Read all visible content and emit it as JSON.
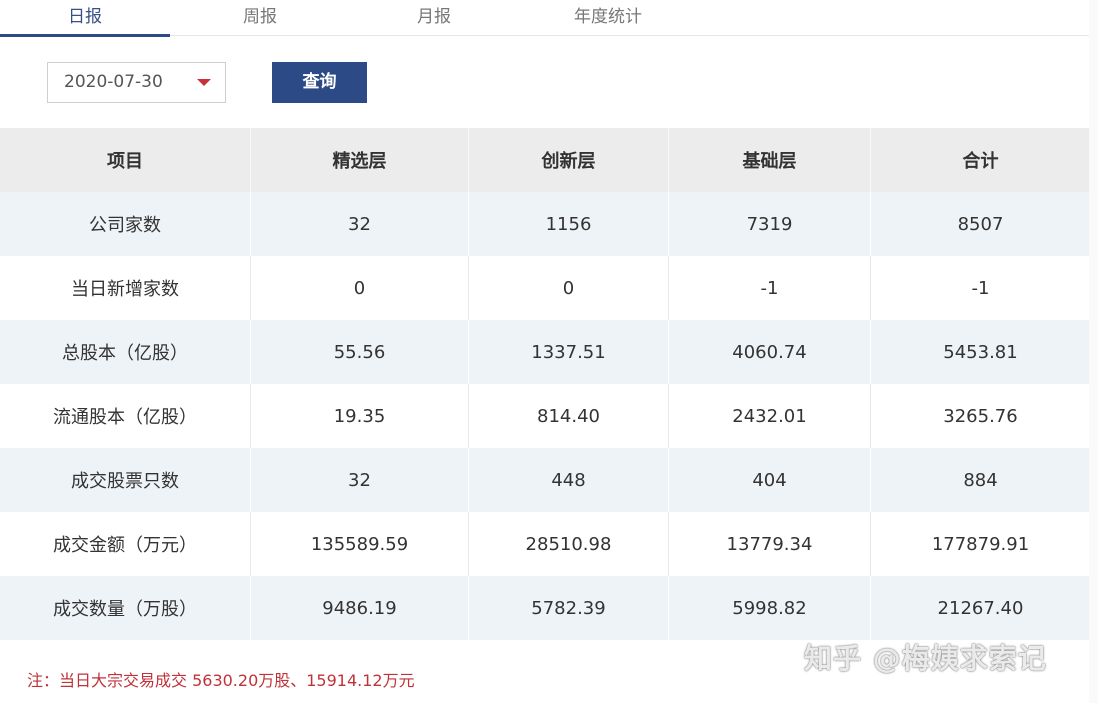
{
  "tabs": [
    {
      "label": "日报"
    },
    {
      "label": "周报"
    },
    {
      "label": "月报"
    },
    {
      "label": "年度统计"
    }
  ],
  "active_tab": "日报",
  "date_picker": {
    "value": "2020-07-30"
  },
  "query_button": {
    "label": "查询"
  },
  "table": {
    "headers": [
      "项目",
      "精选层",
      "创新层",
      "基础层",
      "合计"
    ],
    "rows": [
      [
        "公司家数",
        "32",
        "1156",
        "7319",
        "8507"
      ],
      [
        "当日新增家数",
        "0",
        "0",
        "-1",
        "-1"
      ],
      [
        "总股本（亿股）",
        "55.56",
        "1337.51",
        "4060.74",
        "5453.81"
      ],
      [
        "流通股本（亿股）",
        "19.35",
        "814.40",
        "2432.01",
        "3265.76"
      ],
      [
        "成交股票只数",
        "32",
        "448",
        "404",
        "884"
      ],
      [
        "成交金额（万元）",
        "135589.59",
        "28510.98",
        "13779.34",
        "177879.91"
      ],
      [
        "成交数量（万股）",
        "9486.19",
        "5782.39",
        "5998.82",
        "21267.40"
      ]
    ]
  },
  "note": "注：当日大宗交易成交 5630.20万股、15914.12万元",
  "watermark": "知乎 @梅姨求索记",
  "colors": {
    "accent": "#2b4a86",
    "note": "#c0323a",
    "caret": "#c8303a",
    "header_bg": "#ececec",
    "row_alt_bg": "#eef3f7"
  }
}
